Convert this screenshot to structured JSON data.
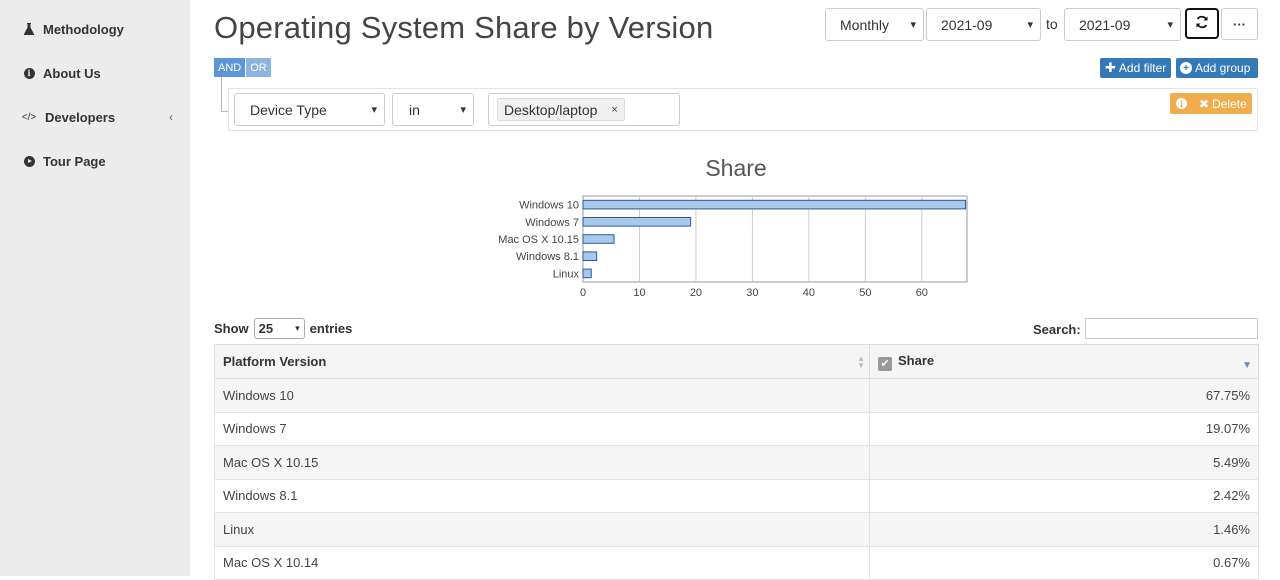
{
  "sidebar": {
    "items": [
      {
        "label": "Methodology",
        "icon": "flask-icon"
      },
      {
        "label": "About Us",
        "icon": "info-circle-icon"
      },
      {
        "label": "Developers",
        "icon": "code-icon"
      },
      {
        "label": "Tour Page",
        "icon": "play-circle-icon"
      }
    ]
  },
  "header": {
    "title": "Operating System Share by Version",
    "granularity": "Monthly",
    "from_date": "2021-09",
    "to_label": "to",
    "to_date": "2021-09"
  },
  "query_builder": {
    "and_label": "AND",
    "or_label": "OR",
    "add_filter_label": "Add filter",
    "add_group_label": "Add group",
    "rule": {
      "field": "Device Type",
      "operator": "in",
      "value_tag": "Desktop/laptop"
    },
    "delete_label": "Delete"
  },
  "chart_data": {
    "type": "bar",
    "orientation": "horizontal",
    "title": "Share",
    "categories": [
      "Windows 10",
      "Windows 7",
      "Mac OS X 10.15",
      "Windows 8.1",
      "Linux"
    ],
    "values": [
      67.75,
      19.07,
      5.49,
      2.42,
      1.46
    ],
    "xticks": [
      "0",
      "10",
      "20",
      "30",
      "40",
      "50",
      "60"
    ],
    "xlim": [
      0,
      68
    ],
    "grid": true,
    "bar_color": "#a8c8ec",
    "bar_stroke": "#2a5a9a"
  },
  "table": {
    "show_label": "Show",
    "entries_value": "25",
    "entries_label": "entries",
    "search_label": "Search:",
    "columns": [
      "Platform Version",
      "Share"
    ],
    "rows": [
      [
        "Windows 10",
        "67.75%"
      ],
      [
        "Windows 7",
        "19.07%"
      ],
      [
        "Mac OS X 10.15",
        "5.49%"
      ],
      [
        "Windows 8.1",
        "2.42%"
      ],
      [
        "Linux",
        "1.46%"
      ],
      [
        "Mac OS X 10.14",
        "0.67%"
      ]
    ]
  }
}
